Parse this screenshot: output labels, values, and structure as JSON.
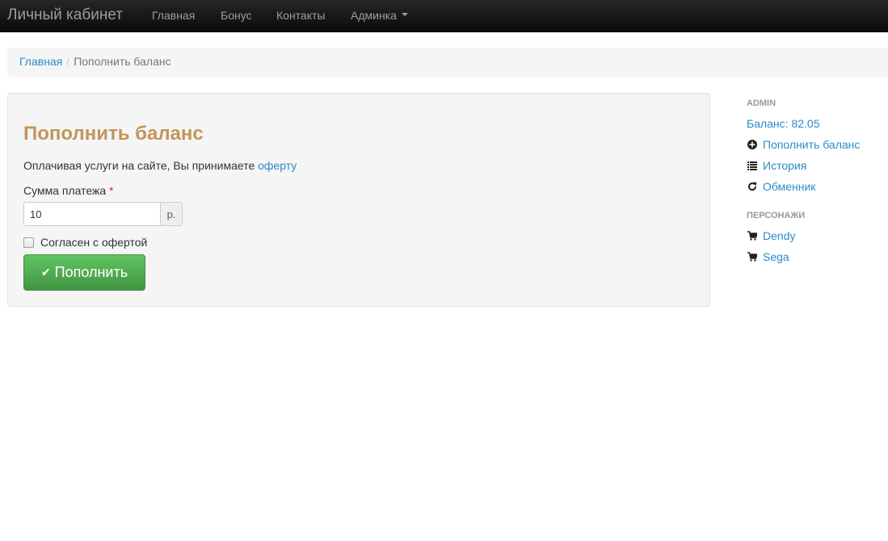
{
  "navbar": {
    "brand": "Личный кабинет",
    "links": [
      "Главная",
      "Бонус",
      "Контакты",
      "Админка"
    ]
  },
  "breadcrumb": {
    "home": "Главная",
    "separator": "/",
    "current": "Пополнить баланс"
  },
  "form": {
    "title": "Пополнить баланс",
    "terms_text": "Оплачивая услуги на сайте, Вы принимаете ",
    "terms_link": "оферту",
    "amount_label": "Сумма платежа",
    "required_mark": "*",
    "amount_value": "10",
    "currency": "р.",
    "agree_label": "Согласен с офертой",
    "submit_label": "Пополнить"
  },
  "sidebar": {
    "admin_header": "ADMIN",
    "balance": "Баланс: 82.05",
    "top_up": "Пополнить баланс",
    "history": "История",
    "exchanger": "Обменник",
    "characters_header": "ПЕРСОНАЖИ",
    "characters": [
      "Dendy",
      "Sega"
    ]
  },
  "colors": {
    "navbar_bg": "#1b1b1b",
    "link": "#2a8bc7",
    "title": "#c2955a",
    "button": "#4cae4c"
  }
}
